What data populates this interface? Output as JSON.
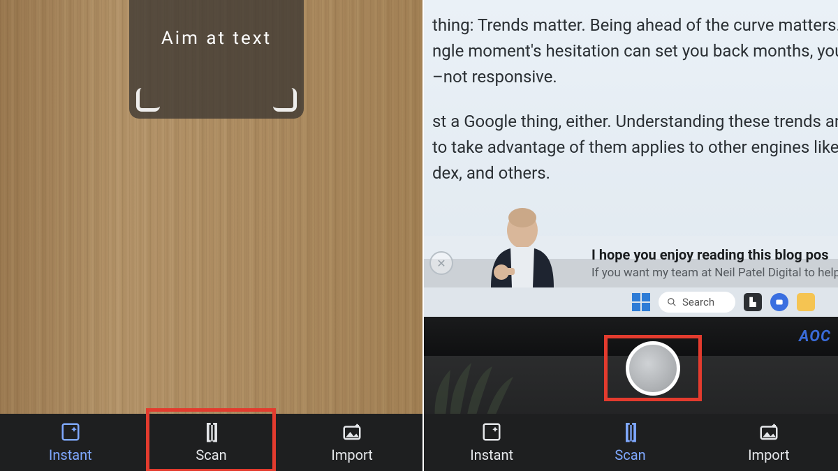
{
  "left": {
    "aim_label": "Aim at text",
    "bottom": {
      "instant": "Instant",
      "scan": "Scan",
      "import": "Import"
    }
  },
  "right": {
    "article": {
      "p1a": "thing: Trends matter. Being ahead of the curve matters. And",
      "p1b": "ngle moment's hesitation can set you back months, you nee",
      "p1c": "–not responsive.",
      "p2a": "st a Google thing, either. Understanding these trends and th",
      "p2b": "to take advantage of them applies to other engines like Bing",
      "p2c": "dex, and others."
    },
    "cta": {
      "title": "I hope you enjoy reading this blog pos",
      "sub": "If you want my team at Neil Patel Digital to help"
    },
    "taskbar": {
      "search": "Search"
    },
    "monitor_brand": "AOC",
    "bottom": {
      "instant": "Instant",
      "scan": "Scan",
      "import": "Import"
    }
  }
}
